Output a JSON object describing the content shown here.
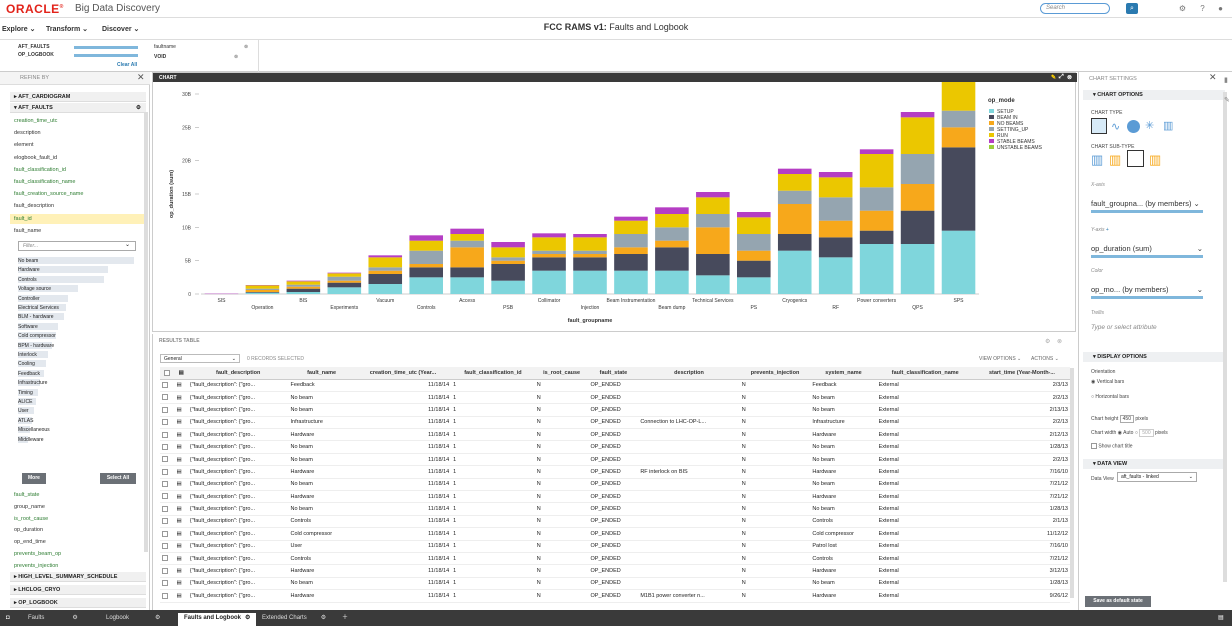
{
  "app": {
    "vendor": "ORACLE",
    "product": "Big Data Discovery",
    "search_placeholder": "Search",
    "page_title_bold": "FCC RAMS v1:",
    "page_title_rest": " Faults and Logbook"
  },
  "menu": [
    "Explore",
    "Transform",
    "Discover"
  ],
  "breadcrumb": {
    "items": [
      "AFT_FAULTS",
      "OP_LOGBOOK"
    ],
    "clear": "Clear All",
    "field": "faultname",
    "value": "VOID"
  },
  "refine": {
    "title": "REFINE BY",
    "groups": [
      "AFT_CARDIOGRAM",
      "AFT_FAULTS"
    ],
    "attrs": [
      {
        "label": "creation_time_utc",
        "green": true
      },
      {
        "label": "description",
        "green": false
      },
      {
        "label": "element",
        "green": false
      },
      {
        "label": "elogbook_fault_id",
        "green": false
      },
      {
        "label": "fault_classification_id",
        "green": true
      },
      {
        "label": "fault_classification_name",
        "green": true
      },
      {
        "label": "fault_creation_source_name",
        "green": true
      },
      {
        "label": "fault_description",
        "green": false
      },
      {
        "label": "fault_id",
        "green": true
      },
      {
        "label": "fault_name",
        "green": false
      }
    ],
    "filter_placeholder": "Filter...",
    "values": [
      "No beam",
      "Hardware",
      "Controls",
      "Voltage source",
      "Controller",
      "Electrical Services",
      "BLM - hardware",
      "Software",
      "Cold compressor",
      "BPM - hardware",
      "Interlock",
      "Cooling",
      "Feedback",
      "Infrastructure",
      "Timing",
      "ALICE",
      "User",
      "ATLAS",
      "Miscellaneous",
      "Middleware"
    ],
    "more": "More",
    "select_all": "Select All",
    "attrs2": [
      {
        "label": "fault_state",
        "green": true
      },
      {
        "label": "group_name",
        "green": false
      },
      {
        "label": "is_root_cause",
        "green": true
      },
      {
        "label": "op_duration",
        "green": false
      },
      {
        "label": "op_end_time",
        "green": false
      },
      {
        "label": "prevents_beam_op",
        "green": true
      },
      {
        "label": "prevents_injection",
        "green": true
      }
    ],
    "groups2": [
      "HIGH_LEVEL_SUMMARY_SCHEDULE",
      "LHCLOG_CRYO",
      "OP_LOGBOOK"
    ]
  },
  "chart": {
    "header": "CHART"
  },
  "chart_data": {
    "type": "bar",
    "stacked": true,
    "xlabel": "fault_groupname",
    "ylabel": "op_duration (sum)",
    "legend_title": "op_mode",
    "legend_position": "top-right",
    "ylim": [
      0,
      30
    ],
    "yticks": [
      "0",
      "5B",
      "10B",
      "15B",
      "20B",
      "25B",
      "30B"
    ],
    "categories": [
      "SIS",
      "Operation",
      "BIS",
      "Experiments",
      "Vacuum",
      "Controls",
      "Access",
      "PSB",
      "Collimator",
      "Injection",
      "Beam Instrumentation",
      "Beam dump",
      "Technical Services",
      "PS",
      "Cryogenics",
      "RF",
      "Power converters",
      "QPS",
      "SPS"
    ],
    "series": [
      {
        "name": "SETUP",
        "color": "#7fd6dc",
        "values": [
          0,
          0.2,
          0.3,
          1.0,
          1.5,
          2.5,
          2.5,
          2.0,
          3.5,
          3.5,
          3.5,
          3.5,
          2.8,
          2.5,
          6.5,
          5.5,
          7.5,
          7.5,
          9.5
        ]
      },
      {
        "name": "BEAM IN",
        "color": "#474a5c",
        "values": [
          0,
          0.1,
          0.5,
          0.7,
          1.5,
          1.5,
          1.5,
          2.5,
          2.0,
          2.0,
          2.5,
          3.5,
          3.2,
          2.5,
          2.5,
          3.0,
          2.0,
          5.0,
          12.5
        ]
      },
      {
        "name": "NO BEAMS",
        "color": "#f7a81b",
        "values": [
          0,
          0.3,
          0.3,
          0.3,
          0.5,
          0.5,
          3.0,
          0.5,
          0.5,
          0.5,
          1.0,
          1.0,
          4.0,
          1.5,
          4.5,
          2.5,
          3.0,
          4.0,
          3.0
        ]
      },
      {
        "name": "SETTING_UP",
        "color": "#95a5b0",
        "values": [
          0,
          0.2,
          0.3,
          0.6,
          0.5,
          2.0,
          1.0,
          0.5,
          0.5,
          0.5,
          2.0,
          2.0,
          2.0,
          2.5,
          2.0,
          3.5,
          3.5,
          4.5,
          2.5
        ]
      },
      {
        "name": "RUN",
        "color": "#ebc700",
        "values": [
          0,
          0.5,
          0.5,
          0.5,
          1.5,
          1.5,
          1.0,
          1.5,
          2.0,
          2.0,
          2.0,
          2.0,
          2.5,
          2.5,
          2.5,
          3.0,
          5.0,
          5.5,
          7.5
        ]
      },
      {
        "name": "STABLE BEAMS",
        "color": "#b53ec4",
        "values": [
          0.05,
          0.05,
          0.1,
          0.1,
          0.3,
          0.8,
          0.8,
          0.8,
          0.6,
          0.5,
          0.6,
          1.0,
          0.8,
          0.8,
          0.8,
          0.8,
          0.7,
          0.8,
          1.0
        ]
      },
      {
        "name": "UNSTABLE BEAMS",
        "color": "#9bcf3a",
        "values": [
          0,
          0,
          0,
          0,
          0,
          0,
          0,
          0,
          0,
          0,
          0,
          0,
          0,
          0,
          0,
          0,
          0,
          0,
          0
        ]
      }
    ]
  },
  "results": {
    "title": "RESULTS TABLE",
    "view_select": "General",
    "records": "0 RECORDS SELECTED",
    "view_options": "VIEW OPTIONS",
    "actions": "ACTIONS",
    "columns": [
      "fault_description",
      "fault_name",
      "creation_time_utc (Year...",
      "fault_classification_id",
      "is_root_cause",
      "fault_state",
      "description",
      "prevents_injection",
      "system_name",
      "fault_classification_name",
      "start_time (Year-Month-..."
    ],
    "rows": [
      [
        "{\"fault_description\": {\"gro...",
        "Feedback",
        "11/18/14",
        "1",
        "N",
        "OP_ENDED",
        "",
        "N",
        "Feedback",
        "External",
        "2/3/13"
      ],
      [
        "{\"fault_description\": {\"gro...",
        "No beam",
        "11/18/14",
        "1",
        "N",
        "OP_ENDED",
        "",
        "N",
        "No beam",
        "External",
        "2/2/13"
      ],
      [
        "{\"fault_description\": {\"gro...",
        "No beam",
        "11/18/14",
        "1",
        "N",
        "OP_ENDED",
        "",
        "N",
        "No beam",
        "External",
        "2/13/13"
      ],
      [
        "{\"fault_description\": {\"gro...",
        "Infrastructure",
        "11/18/14",
        "1",
        "N",
        "OP_ENDED",
        "Connection to LHC-OP-L...",
        "N",
        "Infrastructure",
        "External",
        "2/2/13"
      ],
      [
        "{\"fault_description\": {\"gro...",
        "Hardware",
        "11/18/14",
        "1",
        "N",
        "OP_ENDED",
        "",
        "N",
        "Hardware",
        "External",
        "2/12/13"
      ],
      [
        "{\"fault_description\": {\"gro...",
        "No beam",
        "11/18/14",
        "1",
        "N",
        "OP_ENDED",
        "",
        "N",
        "No beam",
        "External",
        "1/28/13"
      ],
      [
        "{\"fault_description\": {\"gro...",
        "No beam",
        "11/18/14",
        "1",
        "N",
        "OP_ENDED",
        "",
        "N",
        "No beam",
        "External",
        "2/2/13"
      ],
      [
        "{\"fault_description\": {\"gro...",
        "Hardware",
        "11/18/14",
        "1",
        "N",
        "OP_ENDED",
        "RF interlock on BIS",
        "N",
        "Hardware",
        "External",
        "7/16/10"
      ],
      [
        "{\"fault_description\": {\"gro...",
        "No beam",
        "11/18/14",
        "1",
        "N",
        "OP_ENDED",
        "",
        "N",
        "No beam",
        "External",
        "7/21/12"
      ],
      [
        "{\"fault_description\": {\"gro...",
        "Hardware",
        "11/18/14",
        "1",
        "N",
        "OP_ENDED",
        "",
        "N",
        "Hardware",
        "External",
        "7/21/12"
      ],
      [
        "{\"fault_description\": {\"gro...",
        "No beam",
        "11/18/14",
        "1",
        "N",
        "OP_ENDED",
        "",
        "N",
        "No beam",
        "External",
        "1/28/13"
      ],
      [
        "{\"fault_description\": {\"gro...",
        "Controls",
        "11/18/14",
        "1",
        "N",
        "OP_ENDED",
        "",
        "N",
        "Controls",
        "External",
        "2/1/13"
      ],
      [
        "{\"fault_description\": {\"gro...",
        "Cold compressor",
        "11/18/14",
        "1",
        "N",
        "OP_ENDED",
        "",
        "N",
        "Cold compressor",
        "External",
        "11/12/12"
      ],
      [
        "{\"fault_description\": {\"gro...",
        "User",
        "11/18/14",
        "1",
        "N",
        "OP_ENDED",
        "",
        "N",
        "Patrol lost",
        "External",
        "7/16/10"
      ],
      [
        "{\"fault_description\": {\"gro...",
        "Controls",
        "11/18/14",
        "1",
        "N",
        "OP_ENDED",
        "",
        "N",
        "Controls",
        "External",
        "7/21/12"
      ],
      [
        "{\"fault_description\": {\"gro...",
        "Hardware",
        "11/18/14",
        "1",
        "N",
        "OP_ENDED",
        "",
        "N",
        "Hardware",
        "External",
        "3/12/13"
      ],
      [
        "{\"fault_description\": {\"gro...",
        "No beam",
        "11/18/14",
        "1",
        "N",
        "OP_ENDED",
        "",
        "N",
        "No beam",
        "External",
        "1/28/13"
      ],
      [
        "{\"fault_description\": {\"gro...",
        "Hardware",
        "11/18/14",
        "1",
        "N",
        "OP_ENDED",
        "M1B1 power converter n...",
        "N",
        "Hardware",
        "External",
        "9/26/12"
      ]
    ]
  },
  "settings": {
    "title": "CHART SETTINGS",
    "chart_options": "CHART OPTIONS",
    "chart_type": "CHART TYPE",
    "chart_subtype": "CHART SUB-TYPE",
    "xaxis": "X-axis",
    "xaxis_value": "fault_groupna...  (by members)",
    "yaxis": "Y-axis",
    "yaxis_value": "op_duration (sum)",
    "color": "Color",
    "color_value": "op_mo...  (by members)",
    "trellis": "Trellis",
    "trellis_placeholder": "Type or select attribute",
    "display_options": "DISPLAY OPTIONS",
    "orientation": "Orientation",
    "vertical": "Vertical bars",
    "horizontal": "Horizontal bars",
    "chart_height": "Chart height",
    "height_value": "450",
    "pixels": "pixels",
    "chart_width": "Chart width",
    "auto": "Auto",
    "width_value": "500",
    "show_title": "Show chart title",
    "data_view": "DATA VIEW",
    "data_view_label": "Data View",
    "data_view_value": "aft_faults - linked",
    "save_default": "Save as default state"
  },
  "tabs": [
    "Faults",
    "Logbook",
    "Faults and Logbook",
    "Extended Charts"
  ]
}
